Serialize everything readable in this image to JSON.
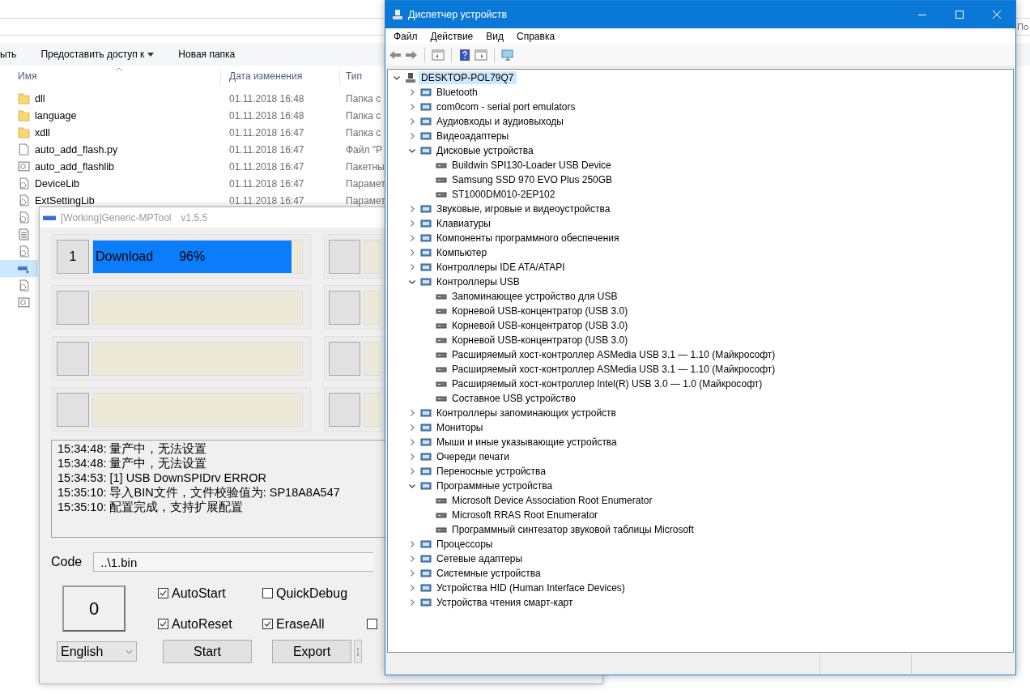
{
  "explorer": {
    "search": {
      "placeholder": "По"
    },
    "ribbon": [
      "ыть",
      "Предоставить доступ к",
      "Новая папка"
    ],
    "columns": [
      "Имя",
      "Дата изменения",
      "Тип"
    ],
    "rows": [
      {
        "kind": "folder",
        "name": "dll",
        "date": "01.11.2018 16:48",
        "type": "Папка с",
        "selected": false
      },
      {
        "kind": "folder",
        "name": "language",
        "date": "01.11.2018 16:48",
        "type": "Папка с",
        "selected": false
      },
      {
        "kind": "folder",
        "name": "xdll",
        "date": "01.11.2018 16:47",
        "type": "Папка с",
        "selected": false
      },
      {
        "kind": "file",
        "name": "auto_add_flash.py",
        "date": "01.11.2018 16:47",
        "type": "Файл \"P",
        "selected": false
      },
      {
        "kind": "script",
        "name": "auto_add_flashlib",
        "date": "01.11.2018 16:47",
        "type": "Пакетны",
        "selected": false
      },
      {
        "kind": "settings",
        "name": "DeviceLib",
        "date": "01.11.2018 16:47",
        "type": "Парамет",
        "selected": false
      },
      {
        "kind": "settings",
        "name": "ExtSettingLib",
        "date": "01.11.2018 16:47",
        "type": "Парамет",
        "selected": false
      },
      {
        "kind": "settings",
        "selected": false
      },
      {
        "kind": "text",
        "selected": false
      },
      {
        "kind": "settings",
        "selected": false
      },
      {
        "kind": "app",
        "selected": true
      },
      {
        "kind": "settings",
        "selected": false
      },
      {
        "kind": "script",
        "selected": false
      }
    ]
  },
  "mptool": {
    "title": "[Working]Generic-MPTool",
    "version": "v1.5.5",
    "slots": [
      {
        "kind": "active",
        "number": "1",
        "status": "Download",
        "percent": "96%",
        "level": 0.95
      },
      {
        "kind": "empty"
      },
      {
        "kind": "empty"
      },
      {
        "kind": "empty"
      },
      {
        "kind": "empty"
      },
      {
        "kind": "empty"
      },
      {
        "kind": "empty"
      },
      {
        "kind": "empty"
      }
    ],
    "log": [
      "15:34:48: 量产中，无法设置",
      "15:34:48: 量产中，无法设置",
      "15:34:53: [1] USB DownSPIDrv ERROR",
      "15:35:10: 导入BIN文件，文件校验值为: SP18A8A547",
      "15:35:10: 配置完成，支持扩展配置"
    ],
    "code_label": "Code",
    "code_value": "..\\1.bin",
    "counter": "0",
    "option_rows": [
      [
        {
          "label": "AutoStart",
          "checked": true
        },
        {
          "label": "QuickDebug",
          "checked": false
        }
      ],
      [
        {
          "label": "AutoReset",
          "checked": true
        },
        {
          "label": "EraseAll",
          "checked": true
        },
        {
          "checked": false
        }
      ]
    ],
    "language": "English",
    "buttons": [
      "Start",
      "Export"
    ]
  },
  "device_manager": {
    "title": "Диспетчер устройств",
    "menu": [
      "Файл",
      "Действие",
      "Вид",
      "Справка"
    ],
    "tree": {
      "label": "DESKTOP-POL79Q7",
      "expanded": true,
      "selected": true,
      "children": [
        {
          "label": "Bluetooth",
          "expanded": false,
          "selected": false
        },
        {
          "label": "com0com - serial port emulators",
          "expanded": false,
          "selected": false
        },
        {
          "label": "Аудиовходы и аудиовыходы",
          "expanded": false,
          "selected": false
        },
        {
          "label": "Видеоадаптеры",
          "expanded": false,
          "selected": false
        },
        {
          "label": "Дисковые устройства",
          "expanded": true,
          "selected": false,
          "children": [
            {
              "label": "Buildwin SPI130-Loader USB Device",
              "selected": false
            },
            {
              "label": "Samsung SSD 970 EVO Plus 250GB",
              "selected": false
            },
            {
              "label": "ST1000DM010-2EP102",
              "selected": false
            }
          ]
        },
        {
          "label": "Звуковые, игровые и видеоустройства",
          "expanded": false,
          "selected": false
        },
        {
          "label": "Клавиатуры",
          "expanded": false,
          "selected": false
        },
        {
          "label": "Компоненты программного обеспечения",
          "expanded": false,
          "selected": false
        },
        {
          "label": "Компьютер",
          "expanded": false,
          "selected": false
        },
        {
          "label": "Контроллеры IDE ATA/ATAPI",
          "expanded": false,
          "selected": false
        },
        {
          "label": "Контроллеры USB",
          "expanded": true,
          "selected": false,
          "children": [
            {
              "label": "Запоминающее устройство для USB",
              "selected": false
            },
            {
              "label": "Корневой USB-концентратор (USB 3.0)",
              "selected": false
            },
            {
              "label": "Корневой USB-концентратор (USB 3.0)",
              "selected": false
            },
            {
              "label": "Корневой USB-концентратор (USB 3.0)",
              "selected": false
            },
            {
              "label": "Расширяемый хост-контроллер ASMedia USB 3.1 — 1.10 (Майкрософт)",
              "selected": false
            },
            {
              "label": "Расширяемый хост-контроллер ASMedia USB 3.1 — 1.10 (Майкрософт)",
              "selected": false
            },
            {
              "label": "Расширяемый хост-контроллер Intel(R) USB 3.0 — 1.0 (Майкрософт)",
              "selected": false
            },
            {
              "label": "Составное USB устройство",
              "selected": false
            }
          ]
        },
        {
          "label": "Контроллеры запоминающих устройств",
          "expanded": false,
          "selected": false
        },
        {
          "label": "Мониторы",
          "expanded": false,
          "selected": false
        },
        {
          "label": "Мыши и иные указывающие устройства",
          "expanded": false,
          "selected": false
        },
        {
          "label": "Очереди печати",
          "expanded": false,
          "selected": false
        },
        {
          "label": "Переносные устройства",
          "expanded": false,
          "selected": false
        },
        {
          "label": "Программные устройства",
          "expanded": true,
          "selected": false,
          "children": [
            {
              "label": "Microsoft Device Association Root Enumerator",
              "selected": false
            },
            {
              "label": "Microsoft RRAS Root Enumerator",
              "selected": false
            },
            {
              "label": "Программный синтезатор звуковой таблицы Microsoft",
              "selected": false
            }
          ]
        },
        {
          "label": "Процессоры",
          "expanded": false,
          "selected": false
        },
        {
          "label": "Сетевые адаптеры",
          "expanded": false,
          "selected": false
        },
        {
          "label": "Системные устройства",
          "expanded": false,
          "selected": false
        },
        {
          "label": "Устройства HID (Human Interface Devices)",
          "expanded": false,
          "selected": false
        },
        {
          "label": "Устройства чтения смарт-карт",
          "expanded": false,
          "selected": false
        }
      ]
    }
  }
}
